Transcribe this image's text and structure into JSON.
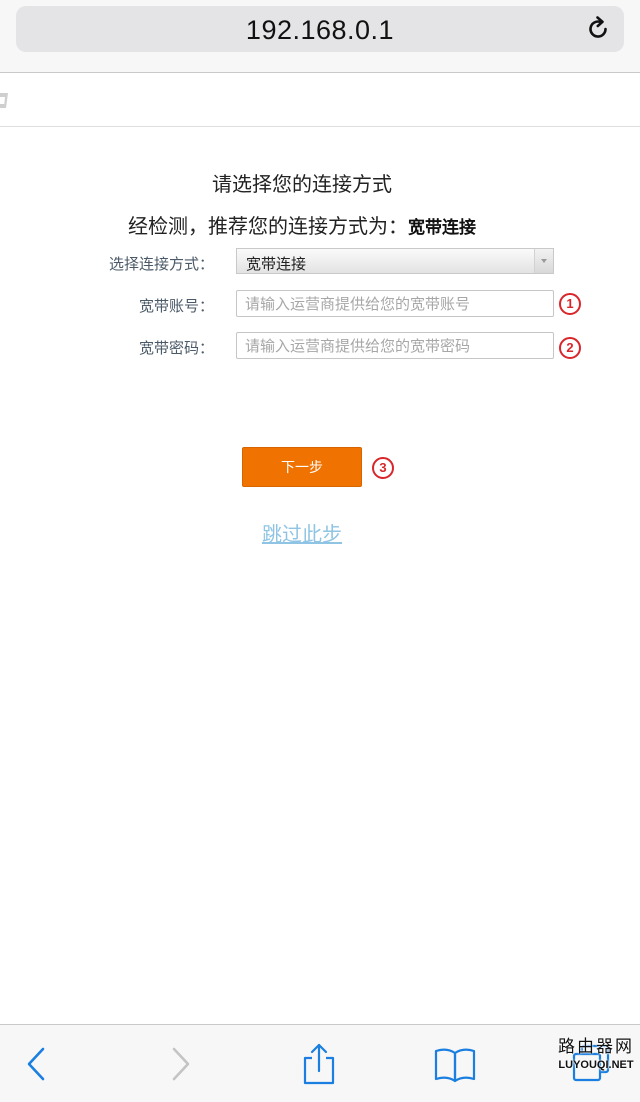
{
  "browser": {
    "url": "192.168.0.1",
    "icons": {
      "reload": "reload-icon",
      "back": "chevron-left-icon",
      "forward": "chevron-right-icon",
      "share": "share-icon",
      "bookmarks": "book-icon",
      "tabs": "tabs-icon"
    }
  },
  "page": {
    "title": "请选择您的连接方式",
    "detect_prefix": "经检测，推荐您的连接方式为：",
    "detect_result": "宽带连接",
    "form": {
      "connection": {
        "label": "选择连接方式：",
        "value": "宽带连接"
      },
      "account": {
        "label": "宽带账号：",
        "value": "",
        "placeholder": "请输入运营商提供给您的宽带账号"
      },
      "password": {
        "label": "宽带密码：",
        "value": "",
        "placeholder": "请输入运营商提供给您的宽带密码"
      }
    },
    "next_label": "下一步",
    "skip_label": "跳过此步"
  },
  "annotations": {
    "step1": "1",
    "step2": "2",
    "step3": "3",
    "color": "#d8262b"
  },
  "watermark": {
    "top": "路由器网",
    "bottom": "LUYOUQI.NET"
  },
  "colors": {
    "accent": "#f07200",
    "link": "#8fc4e4"
  }
}
